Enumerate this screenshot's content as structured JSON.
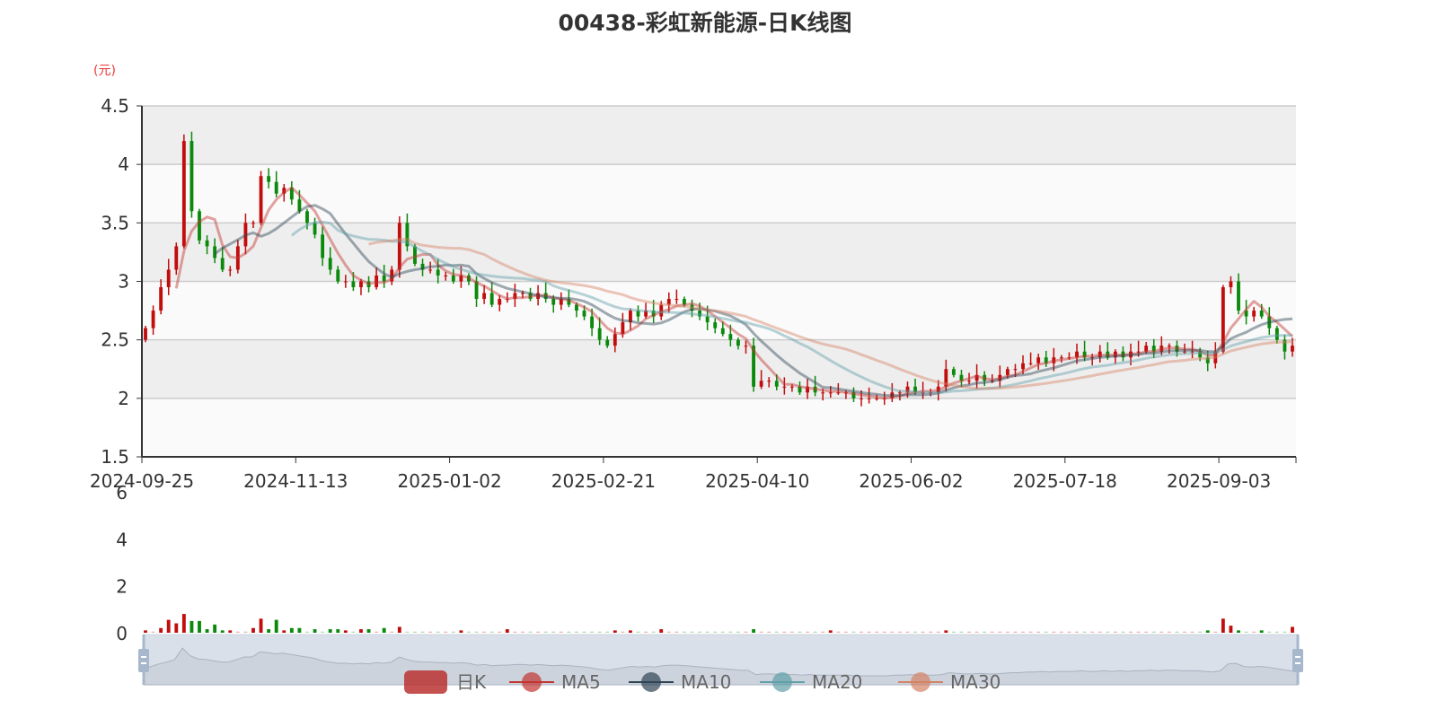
{
  "chart_data": {
    "type": "candlestick",
    "title": "00438-彩虹新能源-日K线图",
    "ylabel": "(元)",
    "ylim": [
      1.5,
      4.5
    ],
    "y_ticks": [
      "4.5",
      "4",
      "3.5",
      "3",
      "2.5",
      "2",
      "1.5"
    ],
    "x_ticks": [
      "2024-09-25",
      "2024-11-13",
      "2025-01-02",
      "2025-02-21",
      "2025-04-10",
      "2025-06-02",
      "2025-07-18",
      "2025-09-03"
    ],
    "volume_ylim": [
      0,
      6
    ],
    "volume_ticks": [
      "6",
      "4",
      "2",
      "0"
    ],
    "legend": [
      "日K",
      "MA5",
      "MA10",
      "MA20",
      "MA30"
    ],
    "colors": {
      "up": "#c20d0d",
      "down": "#0a8a0a",
      "MA5": "#c23531",
      "MA10": "#2f4554",
      "MA20": "#61a0a8",
      "MA30": "#d48265"
    },
    "close": [
      2.6,
      2.75,
      2.95,
      3.1,
      3.3,
      4.2,
      3.6,
      3.35,
      3.3,
      3.2,
      3.1,
      3.1,
      3.3,
      3.5,
      3.5,
      3.9,
      3.85,
      3.75,
      3.8,
      3.7,
      3.6,
      3.5,
      3.4,
      3.2,
      3.1,
      3.0,
      3.0,
      2.95,
      3.0,
      2.95,
      3.05,
      3.0,
      3.1,
      3.5,
      3.3,
      3.15,
      3.1,
      3.1,
      3.05,
      3.05,
      3.0,
      3.05,
      3.0,
      2.85,
      2.9,
      2.8,
      2.85,
      2.85,
      2.9,
      2.9,
      2.85,
      2.9,
      2.85,
      2.8,
      2.85,
      2.8,
      2.75,
      2.7,
      2.6,
      2.5,
      2.45,
      2.55,
      2.65,
      2.75,
      2.7,
      2.75,
      2.7,
      2.8,
      2.85,
      2.85,
      2.8,
      2.75,
      2.7,
      2.65,
      2.6,
      2.55,
      2.5,
      2.45,
      2.45,
      2.1,
      2.15,
      2.15,
      2.1,
      2.1,
      2.1,
      2.05,
      2.1,
      2.05,
      2.05,
      2.05,
      2.05,
      2.05,
      2.0,
      2.0,
      2.0,
      2.0,
      2.0,
      2.05,
      2.05,
      2.1,
      2.05,
      2.05,
      2.05,
      2.1,
      2.25,
      2.2,
      2.15,
      2.15,
      2.2,
      2.15,
      2.15,
      2.2,
      2.25,
      2.25,
      2.3,
      2.3,
      2.35,
      2.3,
      2.35,
      2.35,
      2.35,
      2.4,
      2.35,
      2.35,
      2.4,
      2.35,
      2.4,
      2.35,
      2.4,
      2.4,
      2.45,
      2.4,
      2.45,
      2.45,
      2.4,
      2.4,
      2.4,
      2.35,
      2.3,
      2.4,
      2.95,
      3.0,
      2.75,
      2.7,
      2.75,
      2.7,
      2.6,
      2.5,
      2.4,
      2.45
    ],
    "volume": [
      0.1,
      0.05,
      0.2,
      0.55,
      0.4,
      0.8,
      0.5,
      0.5,
      0.15,
      0.35,
      0.1,
      0.1,
      0.05,
      0.05,
      0.2,
      0.6,
      0.15,
      0.55,
      0.1,
      0.2,
      0.2,
      0.05,
      0.15,
      0.05,
      0.15,
      0.15,
      0.1,
      0.05,
      0.15,
      0.15,
      0.05,
      0.2,
      0.05,
      0.25,
      0.05,
      0.05,
      0.05,
      0.05,
      0.05,
      0.05,
      0.05,
      0.1,
      0.05,
      0.05,
      0.05,
      0.05,
      0.05,
      0.15,
      0.05,
      0.05,
      0.05,
      0.05,
      0.05,
      0.05,
      0.05,
      0.05,
      0.05,
      0.05,
      0.05,
      0.05,
      0.05,
      0.1,
      0.05,
      0.1,
      0.05,
      0.05,
      0.05,
      0.15,
      0.05,
      0.05,
      0.05,
      0.05,
      0.05,
      0.05,
      0.05,
      0.05,
      0.05,
      0.05,
      0.05,
      0.15,
      0.05,
      0.05,
      0.05,
      0.05,
      0.05,
      0.05,
      0.05,
      0.05,
      0.05,
      0.1,
      0.05,
      0.05,
      0.05,
      0.05,
      0.05,
      0.05,
      0.05,
      0.05,
      0.05,
      0.05,
      0.05,
      0.05,
      0.05,
      0.05,
      0.1,
      0.05,
      0.05,
      0.05,
      0.05,
      0.05,
      0.05,
      0.05,
      0.05,
      0.05,
      0.05,
      0.05,
      0.05,
      0.05,
      0.05,
      0.05,
      0.05,
      0.05,
      0.05,
      0.05,
      0.05,
      0.05,
      0.05,
      0.05,
      0.05,
      0.05,
      0.05,
      0.05,
      0.05,
      0.05,
      0.05,
      0.05,
      0.05,
      0.05,
      0.1,
      0.05,
      0.6,
      0.3,
      0.1,
      0.05,
      0.05,
      0.1,
      0.05,
      0.05,
      0.05,
      0.25
    ]
  }
}
